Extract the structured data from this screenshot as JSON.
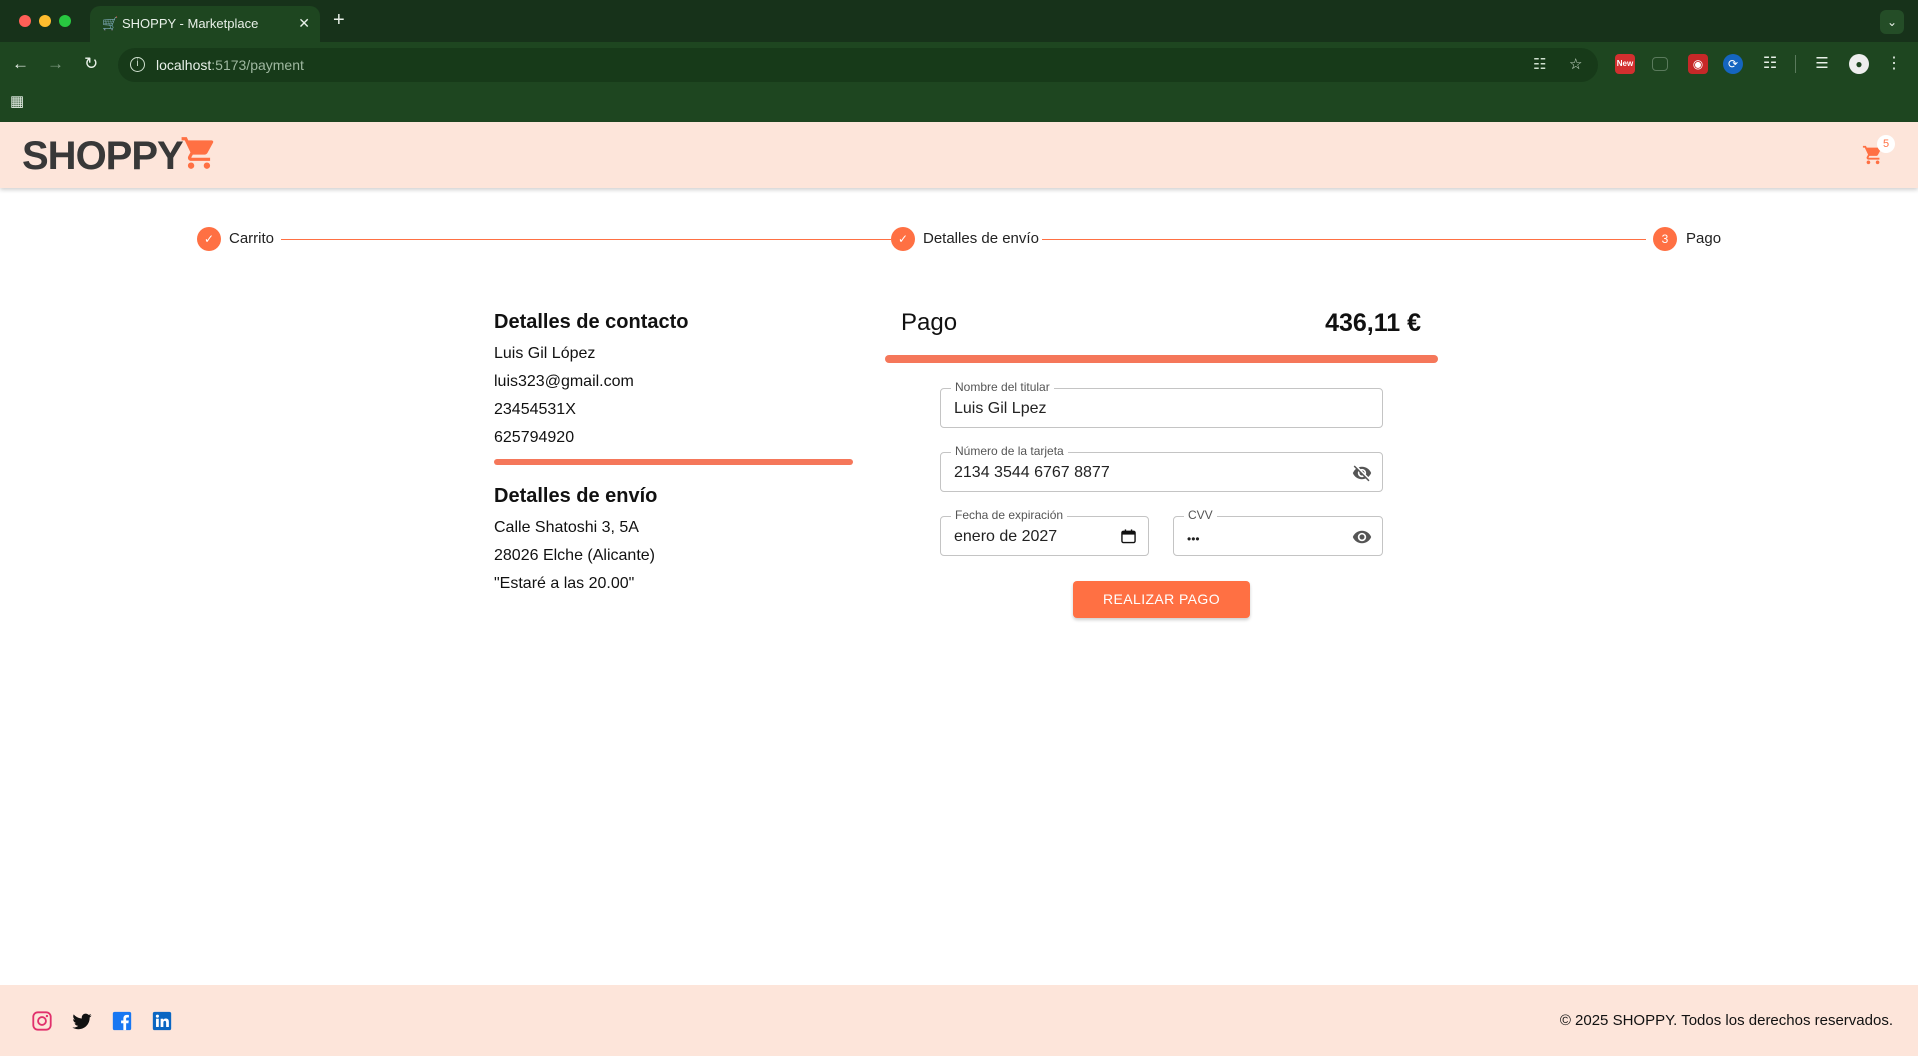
{
  "browser": {
    "tab_title": "SHOPPY - Marketplace",
    "tab_favicon": "cart-icon",
    "new_tab_label": "+",
    "url_host": "localhost",
    "url_rest": ":5173/payment",
    "extensions": {
      "new_badge": "New"
    }
  },
  "header": {
    "logo_text": "SHOPPY",
    "cart_count": "5",
    "brand_color": "#ff7043"
  },
  "stepper": {
    "steps": [
      {
        "label": "Carrito",
        "state": "completed",
        "icon": "check-icon"
      },
      {
        "label": "Detalles de envío",
        "state": "completed",
        "icon": "check-icon"
      },
      {
        "label": "Pago",
        "state": "active",
        "number": "3"
      }
    ]
  },
  "contact": {
    "title": "Detalles de contacto",
    "name": "Luis Gil López",
    "email": "luis323@gmail.com",
    "id_number": "23454531X",
    "phone": "625794920"
  },
  "shipping": {
    "title": "Detalles de envío",
    "address": "Calle Shatoshi 3, 5A",
    "city": "28026 Elche (Alicante)",
    "note": "\"Estaré a las 20.00\""
  },
  "payment": {
    "title": "Pago",
    "amount": "436,11 €",
    "holder_label": "Nombre del titular",
    "holder_value": "Luis Gil Lpez",
    "card_label": "Número de la tarjeta",
    "card_value": "2134 3544 6767 8877",
    "card_toggle_icon": "eye-off-icon",
    "expiry_label": "Fecha de expiración",
    "expiry_value": "enero de 2027",
    "expiry_icon": "calendar-icon",
    "cvv_label": "CVV",
    "cvv_value": "•••",
    "cvv_toggle_icon": "eye-icon",
    "submit_label": "REALIZAR PAGO"
  },
  "footer": {
    "social": [
      "instagram-icon",
      "twitter-icon",
      "facebook-icon",
      "linkedin-icon"
    ],
    "copyright": "© 2025 SHOPPY. Todos los derechos reservados."
  }
}
